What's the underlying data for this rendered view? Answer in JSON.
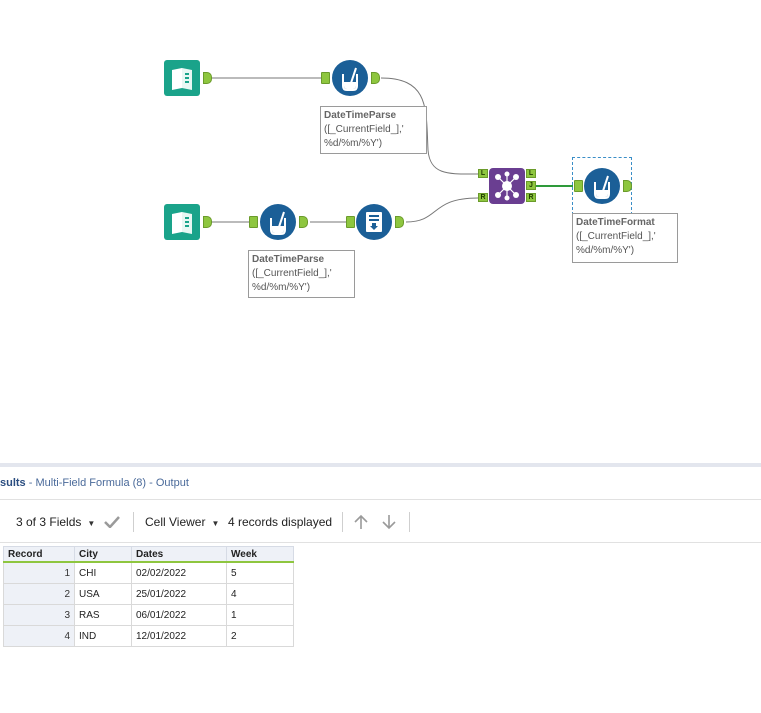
{
  "workflow": {
    "annotations": [
      {
        "id": "formula1",
        "line1": "DateTimeParse",
        "rest": "([_CurrentField_],'\n%d/%m/%Y')"
      },
      {
        "id": "formula2",
        "line1": "DateTimeParse",
        "rest": "([_CurrentField_],'\n%d/%m/%Y')"
      },
      {
        "id": "formula3",
        "line1": "DateTimeFormat",
        "rest": "([_CurrentField_],'\n%d/%m/%Y')"
      }
    ],
    "join_anchors": {
      "left": "L",
      "right": "R",
      "out_left": "L",
      "out_join": "J",
      "out_right": "R"
    },
    "colors": {
      "input_tool": "#1aa38a",
      "formula_tool": "#1b5f97",
      "join_tool": "#6a3e91",
      "anchor": "#8ec63f",
      "selected_wire": "#2e9a3a"
    }
  },
  "results": {
    "title_prefix": "sults",
    "title_rest": " - Multi-Field Formula (8) - Output",
    "toolbar": {
      "fields_label": "3 of 3 Fields",
      "cell_viewer_label": "Cell Viewer",
      "records_label": "4 records displayed"
    },
    "columns": [
      "Record",
      "City",
      "Dates",
      "Week"
    ],
    "rows": [
      [
        "1",
        "CHI",
        "02/02/2022",
        "5"
      ],
      [
        "2",
        "USA",
        "25/01/2022",
        "4"
      ],
      [
        "3",
        "RAS",
        "06/01/2022",
        "1"
      ],
      [
        "4",
        "IND",
        "12/01/2022",
        "2"
      ]
    ]
  }
}
